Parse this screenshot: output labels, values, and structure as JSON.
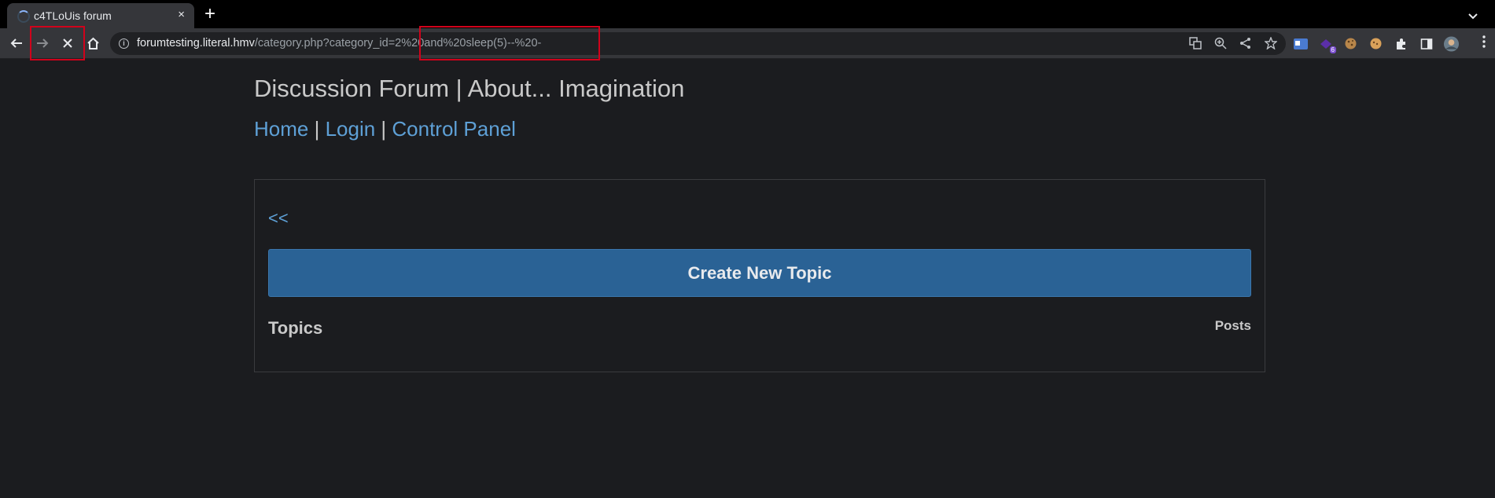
{
  "browser": {
    "tab_title": "c4TLoUis forum",
    "new_tab_symbol": "+",
    "close_tab_symbol": "×",
    "url_host": "forumtesting.literal.hmv",
    "url_path": "/category.php?category_id=2%20and%20sleep(5)--%20-",
    "extension_badge": "6",
    "icons": [
      "back-icon",
      "forward-icon",
      "stop-icon",
      "home-icon",
      "info-icon",
      "translate-icon",
      "zoom-icon",
      "share-icon",
      "star-icon",
      "extensions-icon",
      "sidebar-icon",
      "profile-avatar",
      "menu-icon"
    ]
  },
  "site": {
    "title": "Discussion Forum | About... Imagination",
    "nav": {
      "home": "Home",
      "sep1": " | ",
      "login": "Login",
      "sep2": " | ",
      "control_panel": "Control Panel"
    }
  },
  "category": {
    "back_link": "<<",
    "create_button": "Create New Topic",
    "topics_header": "Topics",
    "posts_header": "Posts"
  },
  "colors": {
    "page_bg": "#1b1c1f",
    "link": "#5ea0d6",
    "button": "#2a6295",
    "annotation": "#d0021b"
  }
}
